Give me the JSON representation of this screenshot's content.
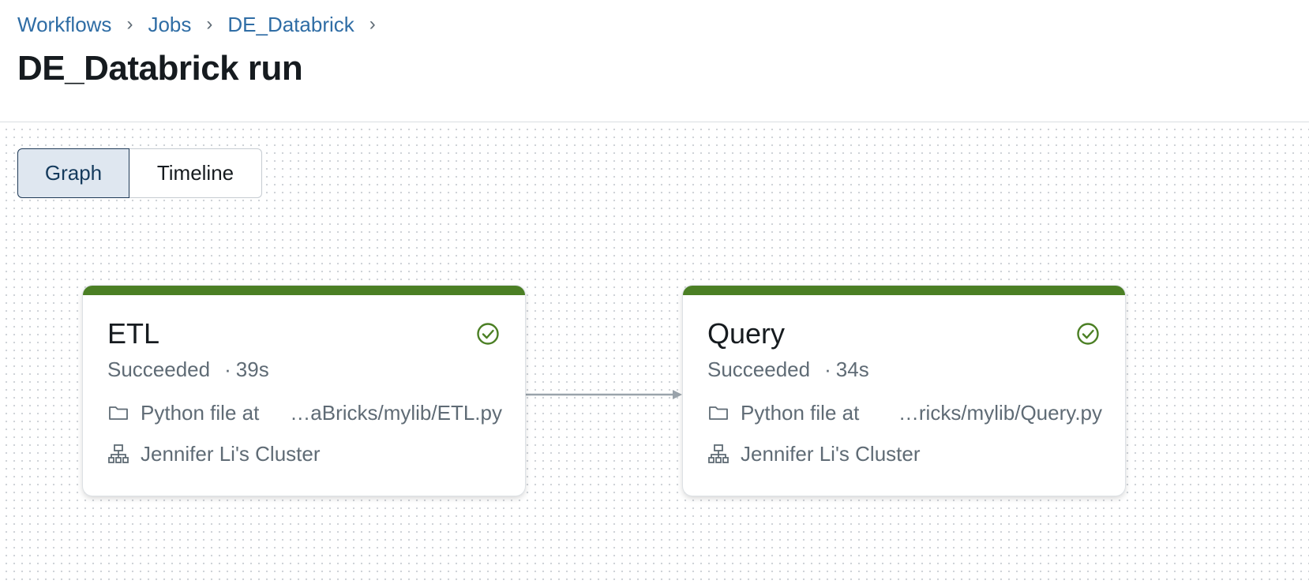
{
  "breadcrumb": {
    "items": [
      "Workflows",
      "Jobs",
      "DE_Databrick"
    ],
    "separator": "›"
  },
  "page": {
    "title": "DE_Databrick run"
  },
  "view_toggle": {
    "graph_label": "Graph",
    "timeline_label": "Timeline",
    "selected": "Graph"
  },
  "tasks": [
    {
      "name": "ETL",
      "status": "Succeeded",
      "duration_separator": "·",
      "duration": "39s",
      "file_label": "Python file at",
      "file_path": "…aBricks/mylib/ETL.py",
      "cluster": "Jennifer Li's Cluster"
    },
    {
      "name": "Query",
      "status": "Succeeded",
      "duration_separator": "·",
      "duration": "34s",
      "file_label": "Python file at",
      "file_path": "…ricks/mylib/Query.py",
      "cluster": "Jennifer Li's Cluster"
    }
  ],
  "colors": {
    "success": "#4b7f24",
    "link": "#2f6da5",
    "muted_text": "#5f6b75",
    "toggle_active_bg": "#dfe7f0"
  },
  "icons": {
    "status": "check-circle-icon",
    "file": "folder-icon",
    "cluster": "cluster-icon"
  }
}
